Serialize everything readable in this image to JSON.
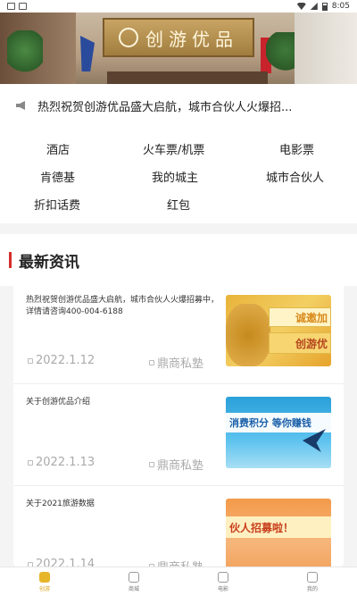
{
  "status_bar": {
    "time": "8:05"
  },
  "banner": {
    "sign_text": "创游优品"
  },
  "notice": {
    "text": "热烈祝贺创游优品盛大启航，城市合伙人火爆招..."
  },
  "menu": {
    "items": [
      {
        "label": "酒店"
      },
      {
        "label": "火车票/机票"
      },
      {
        "label": "电影票"
      },
      {
        "label": "肯德基"
      },
      {
        "label": "我的城主"
      },
      {
        "label": "城市合伙人"
      },
      {
        "label": "折扣话费"
      },
      {
        "label": "红包"
      }
    ]
  },
  "news": {
    "section_title": "最新资讯",
    "articles": [
      {
        "title": "热烈祝贺创游优品盛大启航，城市合伙人火爆招募中，详情请咨询400-004-6188",
        "date": "2022.1.12",
        "author": "鼎商私塾",
        "thumb_text_1": "诚邀加",
        "thumb_text_2": "创游优"
      },
      {
        "title": "关于创游优品介绍",
        "date": "2022.1.13",
        "author": "鼎商私塾",
        "thumb_text_1": "消费积分  等你赚钱"
      },
      {
        "title": "关于2021旅游数据",
        "date": "2022.1.14",
        "author": "鼎商私塾",
        "thumb_text_1": "伙人招募啦！"
      }
    ]
  },
  "tabbar": {
    "tabs": [
      {
        "label": "创游"
      },
      {
        "label": "商城"
      },
      {
        "label": "电影"
      },
      {
        "label": "我的"
      }
    ]
  },
  "colors": {
    "accent": "#d62d2d",
    "tab_active": "#e6b52a"
  }
}
